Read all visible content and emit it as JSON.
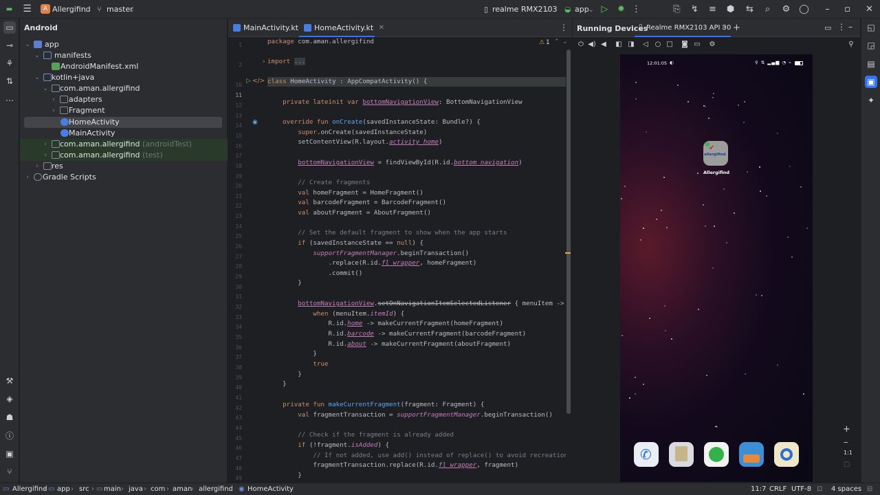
{
  "titlebar": {
    "project_name": "Allergifind",
    "project_letter": "A",
    "branch": "master",
    "device": "realme RMX2103",
    "run_config": "app"
  },
  "project_panel": {
    "view_mode": "Android",
    "tree": [
      {
        "label": "app",
        "suffix": ""
      },
      {
        "label": "manifests",
        "suffix": ""
      },
      {
        "label": "AndroidManifest.xml",
        "suffix": ""
      },
      {
        "label": "kotlin+java",
        "suffix": ""
      },
      {
        "label": "com.aman.allergifind",
        "suffix": ""
      },
      {
        "label": "adapters",
        "suffix": ""
      },
      {
        "label": "Fragment",
        "suffix": ""
      },
      {
        "label": "HomeActivity",
        "suffix": ""
      },
      {
        "label": "MainActivity",
        "suffix": ""
      },
      {
        "label": "com.aman.allergifind",
        "suffix": "(androidTest)"
      },
      {
        "label": "com.aman.allergifind",
        "suffix": "(test)"
      },
      {
        "label": "res",
        "suffix": ""
      },
      {
        "label": "Gradle Scripts",
        "suffix": ""
      }
    ]
  },
  "editor": {
    "tabs": [
      {
        "label": "MainActivity.kt"
      },
      {
        "label": "HomeActivity.kt"
      }
    ],
    "warning_count": "1",
    "line_numbers": [
      "1",
      "2",
      "10",
      "11",
      "12",
      "13",
      "14",
      "15",
      "16",
      "17",
      "18",
      "19",
      "20",
      "21",
      "22",
      "23",
      "24",
      "25",
      "26",
      "27",
      "28",
      "29",
      "30",
      "31",
      "32",
      "33",
      "34",
      "35",
      "36",
      "37",
      "38",
      "39",
      "40",
      "41",
      "42",
      "43",
      "44",
      "45",
      "46",
      "47",
      "48",
      "49",
      "50"
    ]
  },
  "devices_panel": {
    "title": "Running Devices",
    "device_tab": "Realme RMX2103 API 30",
    "phone": {
      "time": "12:01:05",
      "app_label": "Allergifind",
      "app_icon_text": "allergifind"
    },
    "zoom_label": "1:1"
  },
  "statusline": {
    "breadcrumbs": [
      "Allergifind",
      "app",
      "src",
      "main",
      "java",
      "com",
      "aman",
      "allergifind",
      "HomeActivity"
    ],
    "position": "11:7",
    "line_sep": "CRLF",
    "encoding": "UTF-8",
    "indent": "4 spaces"
  }
}
